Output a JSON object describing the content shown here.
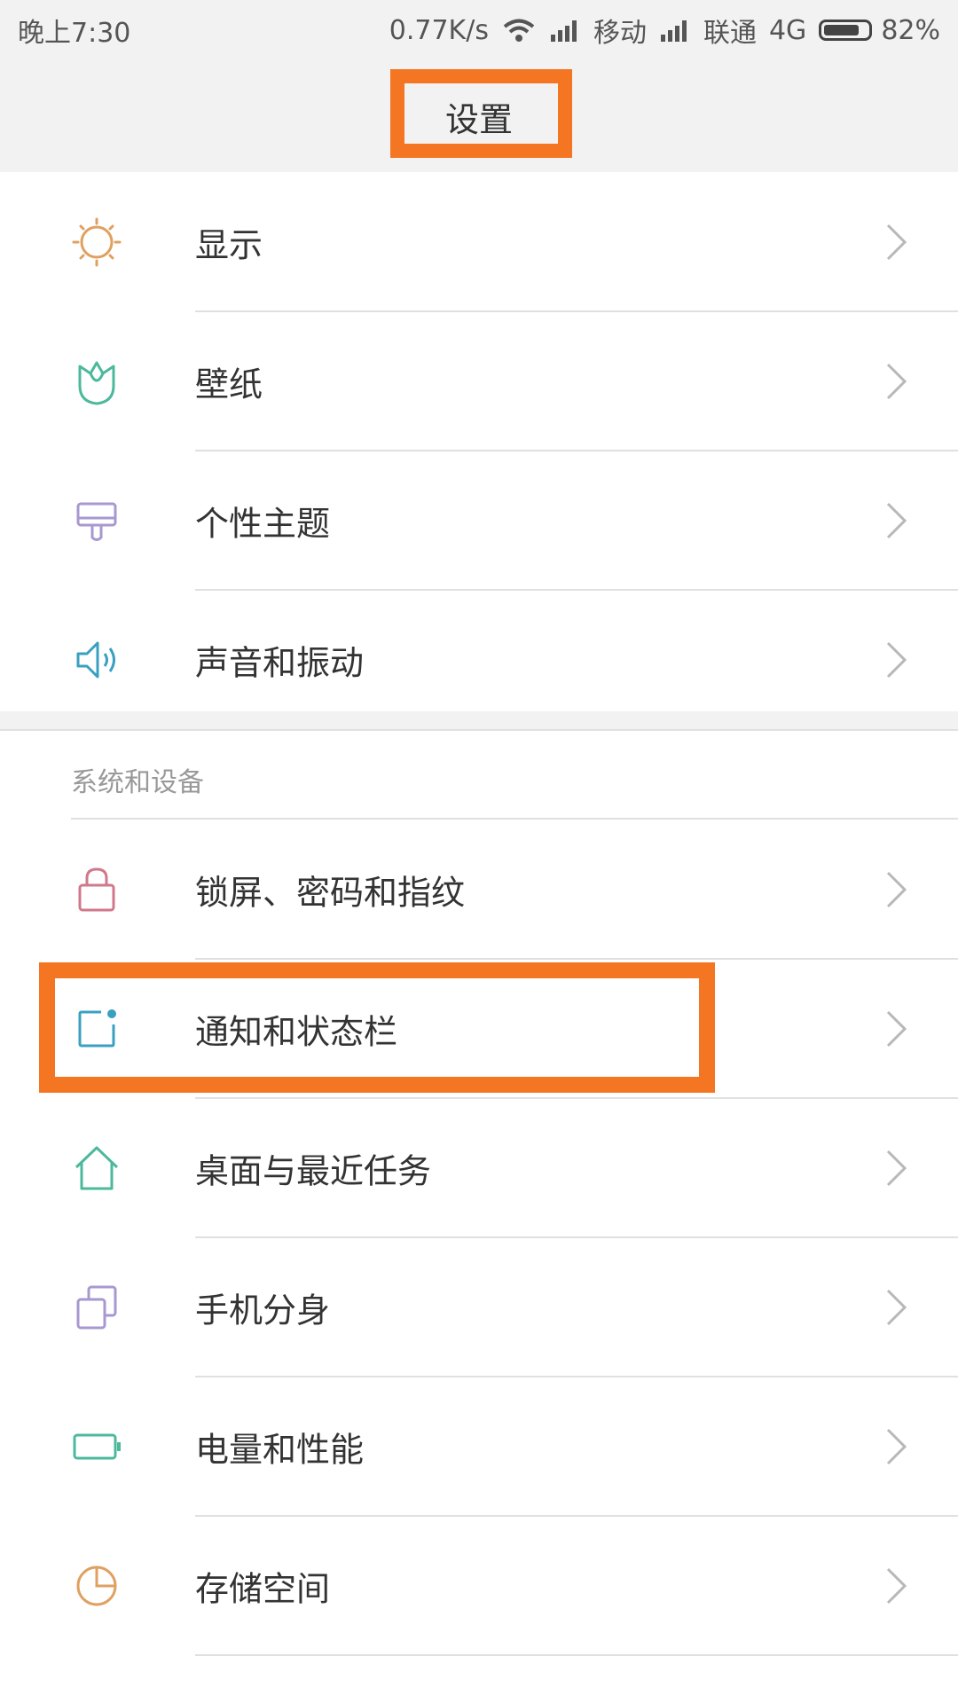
{
  "status_bar": {
    "time": "晚上7:30",
    "speed": "0.77K/s",
    "carrier1": "移动",
    "carrier2": "联通",
    "network": "4G",
    "battery": "82%",
    "battery_level": 0.82
  },
  "title": "设置",
  "items_top": [
    {
      "label": "显示",
      "icon": "sun-icon"
    },
    {
      "label": "壁纸",
      "icon": "tulip-icon"
    },
    {
      "label": "个性主题",
      "icon": "paintbrush-icon"
    },
    {
      "label": "声音和振动",
      "icon": "speaker-icon"
    }
  ],
  "section_header": "系统和设备",
  "items_system": [
    {
      "label": "锁屏、密码和指纹",
      "icon": "lock-icon"
    },
    {
      "label": "通知和状态栏",
      "icon": "notification-icon"
    },
    {
      "label": "桌面与最近任务",
      "icon": "home-icon"
    },
    {
      "label": "手机分身",
      "icon": "dual-app-icon"
    },
    {
      "label": "电量和性能",
      "icon": "battery-icon"
    },
    {
      "label": "存储空间",
      "icon": "pie-chart-icon"
    }
  ],
  "colors": {
    "highlight": "#f47623",
    "sun": "#e0a060",
    "tulip": "#4cb89c",
    "paintbrush": "#a898d0",
    "speaker": "#3aa0c0",
    "lock": "#d0788c",
    "notification": "#3aa0c0",
    "home": "#4cb89c",
    "dual_app": "#a898d0",
    "battery": "#4cb89c",
    "pie": "#e0a060"
  }
}
